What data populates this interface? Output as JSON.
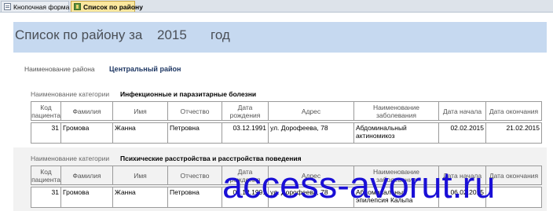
{
  "tabs": [
    {
      "label": "Кнопочная форма",
      "icon": "form-icon"
    },
    {
      "label": "Список по району",
      "icon": "report-icon"
    }
  ],
  "header": {
    "title": "Список по району за",
    "year": "2015",
    "suffix": "год"
  },
  "district": {
    "caption": "Наименование района",
    "value": "Центральный район"
  },
  "columns": [
    "Код пациента",
    "Фамилия",
    "Имя",
    "Отчество",
    "Дата рождения",
    "Адрес",
    "Наименование заболевания",
    "Дата начала",
    "Дата окончания"
  ],
  "sections": [
    {
      "category_caption": "Наименование категории",
      "category": "Инфекционные и паразитарные болезни",
      "rows": [
        {
          "code": "31",
          "last_name": "Громова",
          "first_name": "Жанна",
          "patronymic": "Петровна",
          "birth_date": "03.12.1991",
          "address": "ул. Дорофеева, 78",
          "disease": "Абдоминальный актиномикоз",
          "start_date": "02.02.2015",
          "end_date": "21.02.2015"
        }
      ]
    },
    {
      "category_caption": "Наименование категории",
      "category": "Психические расстройства и расстройства поведения",
      "rows": [
        {
          "code": "31",
          "last_name": "Громова",
          "first_name": "Жанна",
          "patronymic": "Петровна",
          "birth_date": "03.12.1991",
          "address": "ул. Дорофеева, 78",
          "disease": "Абдоминальный эпилепсия Кальпа",
          "start_date": "06.02.2015",
          "end_date": ""
        }
      ]
    }
  ],
  "watermark": "access-avorut.ru"
}
